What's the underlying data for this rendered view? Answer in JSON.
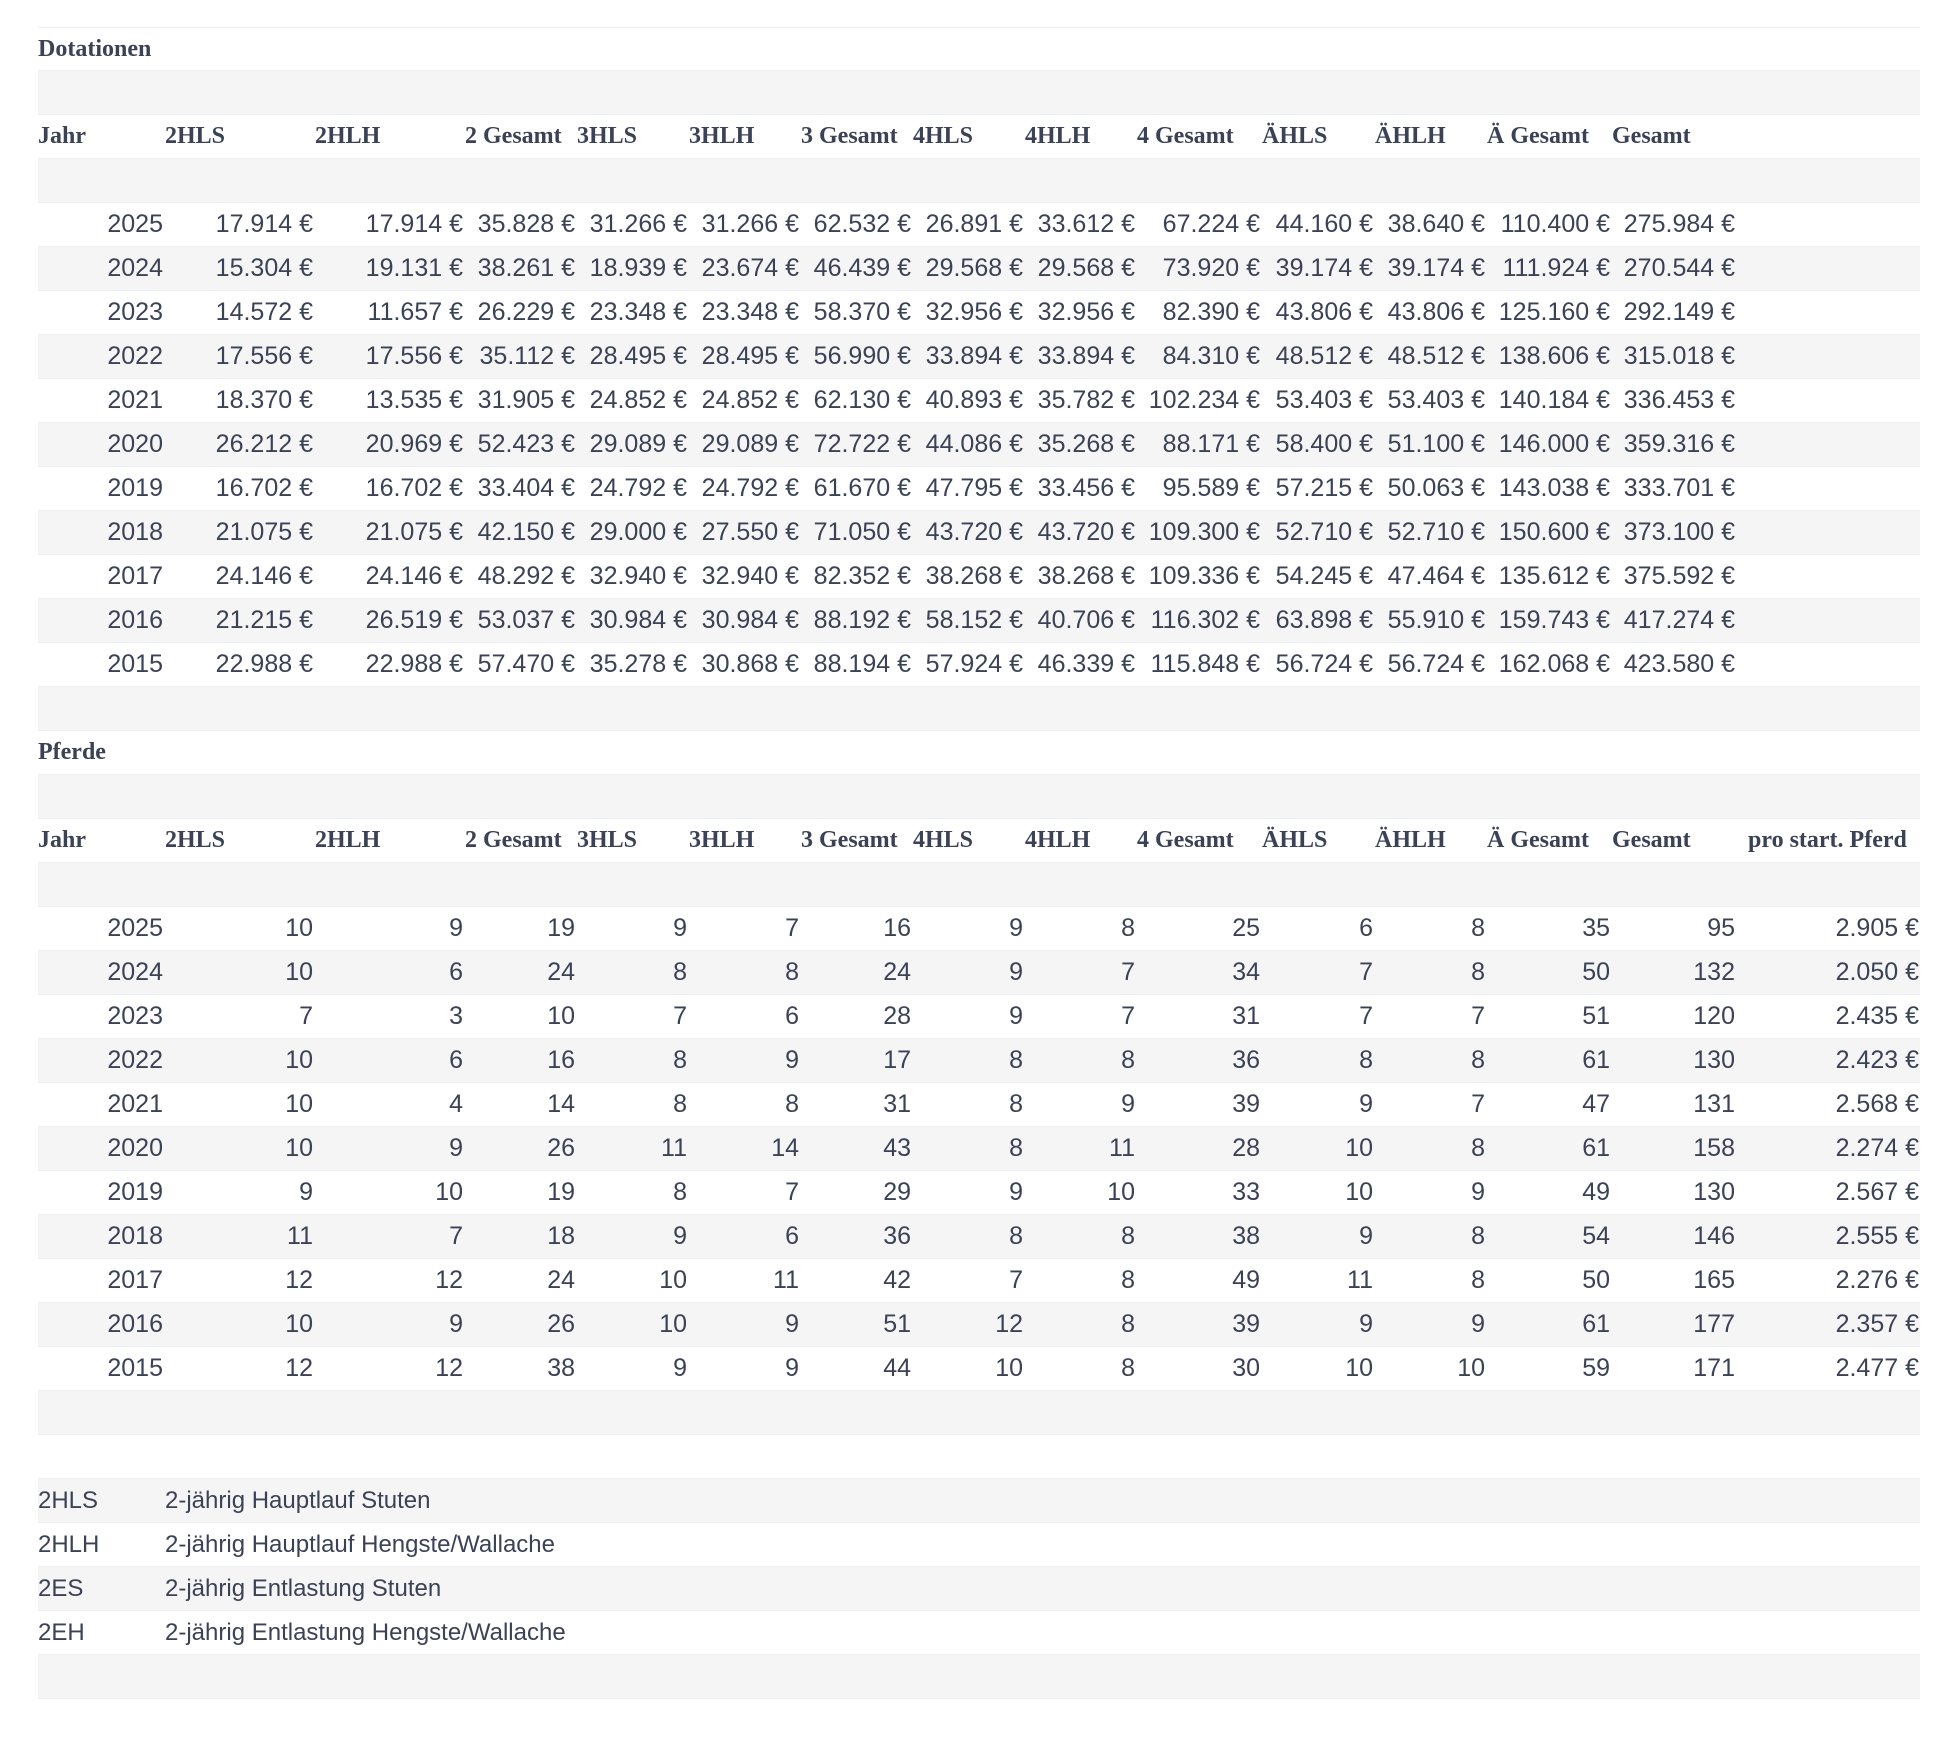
{
  "dotationen": {
    "title": "Dotationen",
    "headers": [
      "Jahr",
      "2HLS",
      "2HLH",
      "2 Gesamt",
      "3HLS",
      "3HLH",
      "3 Gesamt",
      "4HLS",
      "4HLH",
      "4 Gesamt",
      "ÄHLS",
      "ÄHLH",
      "Ä Gesamt",
      "Gesamt"
    ],
    "rows": [
      [
        "2025",
        "17.914 €",
        "17.914 €",
        "35.828 €",
        "31.266 €",
        "31.266 €",
        "62.532 €",
        "26.891 €",
        "33.612 €",
        "67.224 €",
        "44.160 €",
        "38.640 €",
        "110.400 €",
        "275.984 €"
      ],
      [
        "2024",
        "15.304 €",
        "19.131 €",
        "38.261 €",
        "18.939 €",
        "23.674 €",
        "46.439 €",
        "29.568 €",
        "29.568 €",
        "73.920 €",
        "39.174 €",
        "39.174 €",
        "111.924 €",
        "270.544 €"
      ],
      [
        "2023",
        "14.572 €",
        "11.657 €",
        "26.229 €",
        "23.348 €",
        "23.348 €",
        "58.370 €",
        "32.956 €",
        "32.956 €",
        "82.390 €",
        "43.806 €",
        "43.806 €",
        "125.160 €",
        "292.149 €"
      ],
      [
        "2022",
        "17.556 €",
        "17.556 €",
        "35.112 €",
        "28.495 €",
        "28.495 €",
        "56.990 €",
        "33.894 €",
        "33.894 €",
        "84.310 €",
        "48.512 €",
        "48.512 €",
        "138.606 €",
        "315.018 €"
      ],
      [
        "2021",
        "18.370 €",
        "13.535 €",
        "31.905 €",
        "24.852 €",
        "24.852 €",
        "62.130 €",
        "40.893 €",
        "35.782 €",
        "102.234 €",
        "53.403 €",
        "53.403 €",
        "140.184 €",
        "336.453 €"
      ],
      [
        "2020",
        "26.212 €",
        "20.969 €",
        "52.423 €",
        "29.089 €",
        "29.089 €",
        "72.722 €",
        "44.086 €",
        "35.268 €",
        "88.171 €",
        "58.400 €",
        "51.100 €",
        "146.000 €",
        "359.316 €"
      ],
      [
        "2019",
        "16.702 €",
        "16.702 €",
        "33.404 €",
        "24.792 €",
        "24.792 €",
        "61.670 €",
        "47.795 €",
        "33.456 €",
        "95.589 €",
        "57.215 €",
        "50.063 €",
        "143.038 €",
        "333.701 €"
      ],
      [
        "2018",
        "21.075 €",
        "21.075 €",
        "42.150 €",
        "29.000 €",
        "27.550 €",
        "71.050 €",
        "43.720 €",
        "43.720 €",
        "109.300 €",
        "52.710 €",
        "52.710 €",
        "150.600 €",
        "373.100 €"
      ],
      [
        "2017",
        "24.146 €",
        "24.146 €",
        "48.292 €",
        "32.940 €",
        "32.940 €",
        "82.352 €",
        "38.268 €",
        "38.268 €",
        "109.336 €",
        "54.245 €",
        "47.464 €",
        "135.612 €",
        "375.592 €"
      ],
      [
        "2016",
        "21.215 €",
        "26.519 €",
        "53.037 €",
        "30.984 €",
        "30.984 €",
        "88.192 €",
        "58.152 €",
        "40.706 €",
        "116.302 €",
        "63.898 €",
        "55.910 €",
        "159.743 €",
        "417.274 €"
      ],
      [
        "2015",
        "22.988 €",
        "22.988 €",
        "57.470 €",
        "35.278 €",
        "30.868 €",
        "88.194 €",
        "57.924 €",
        "46.339 €",
        "115.848 €",
        "56.724 €",
        "56.724 €",
        "162.068 €",
        "423.580 €"
      ]
    ]
  },
  "pferde": {
    "title": "Pferde",
    "headers": [
      "Jahr",
      "2HLS",
      "2HLH",
      "2 Gesamt",
      "3HLS",
      "3HLH",
      "3 Gesamt",
      "4HLS",
      "4HLH",
      "4 Gesamt",
      "ÄHLS",
      "ÄHLH",
      "Ä Gesamt",
      "Gesamt",
      "pro start. Pferd"
    ],
    "rows": [
      [
        "2025",
        "10",
        "9",
        "19",
        "9",
        "7",
        "16",
        "9",
        "8",
        "25",
        "6",
        "8",
        "35",
        "95",
        "2.905 €"
      ],
      [
        "2024",
        "10",
        "6",
        "24",
        "8",
        "8",
        "24",
        "9",
        "7",
        "34",
        "7",
        "8",
        "50",
        "132",
        "2.050 €"
      ],
      [
        "2023",
        "7",
        "3",
        "10",
        "7",
        "6",
        "28",
        "9",
        "7",
        "31",
        "7",
        "7",
        "51",
        "120",
        "2.435 €"
      ],
      [
        "2022",
        "10",
        "6",
        "16",
        "8",
        "9",
        "17",
        "8",
        "8",
        "36",
        "8",
        "8",
        "61",
        "130",
        "2.423 €"
      ],
      [
        "2021",
        "10",
        "4",
        "14",
        "8",
        "8",
        "31",
        "8",
        "9",
        "39",
        "9",
        "7",
        "47",
        "131",
        "2.568 €"
      ],
      [
        "2020",
        "10",
        "9",
        "26",
        "11",
        "14",
        "43",
        "8",
        "11",
        "28",
        "10",
        "8",
        "61",
        "158",
        "2.274 €"
      ],
      [
        "2019",
        "9",
        "10",
        "19",
        "8",
        "7",
        "29",
        "9",
        "10",
        "33",
        "10",
        "9",
        "49",
        "130",
        "2.567 €"
      ],
      [
        "2018",
        "11",
        "7",
        "18",
        "9",
        "6",
        "36",
        "8",
        "8",
        "38",
        "9",
        "8",
        "54",
        "146",
        "2.555 €"
      ],
      [
        "2017",
        "12",
        "12",
        "24",
        "10",
        "11",
        "42",
        "7",
        "8",
        "49",
        "11",
        "8",
        "50",
        "165",
        "2.276 €"
      ],
      [
        "2016",
        "10",
        "9",
        "26",
        "10",
        "9",
        "51",
        "12",
        "8",
        "39",
        "9",
        "9",
        "61",
        "177",
        "2.357 €"
      ],
      [
        "2015",
        "12",
        "12",
        "38",
        "9",
        "9",
        "44",
        "10",
        "8",
        "30",
        "10",
        "10",
        "59",
        "171",
        "2.477 €"
      ]
    ]
  },
  "legend": [
    {
      "key": "2HLS",
      "value": "2-jährig Hauptlauf Stuten"
    },
    {
      "key": "2HLH",
      "value": "2-jährig Hauptlauf Hengste/Wallache"
    },
    {
      "key": "2ES",
      "value": "2-jährig Entlastung Stuten"
    },
    {
      "key": "2EH",
      "value": "2-jährig Entlastung Hengste/Wallache"
    }
  ]
}
